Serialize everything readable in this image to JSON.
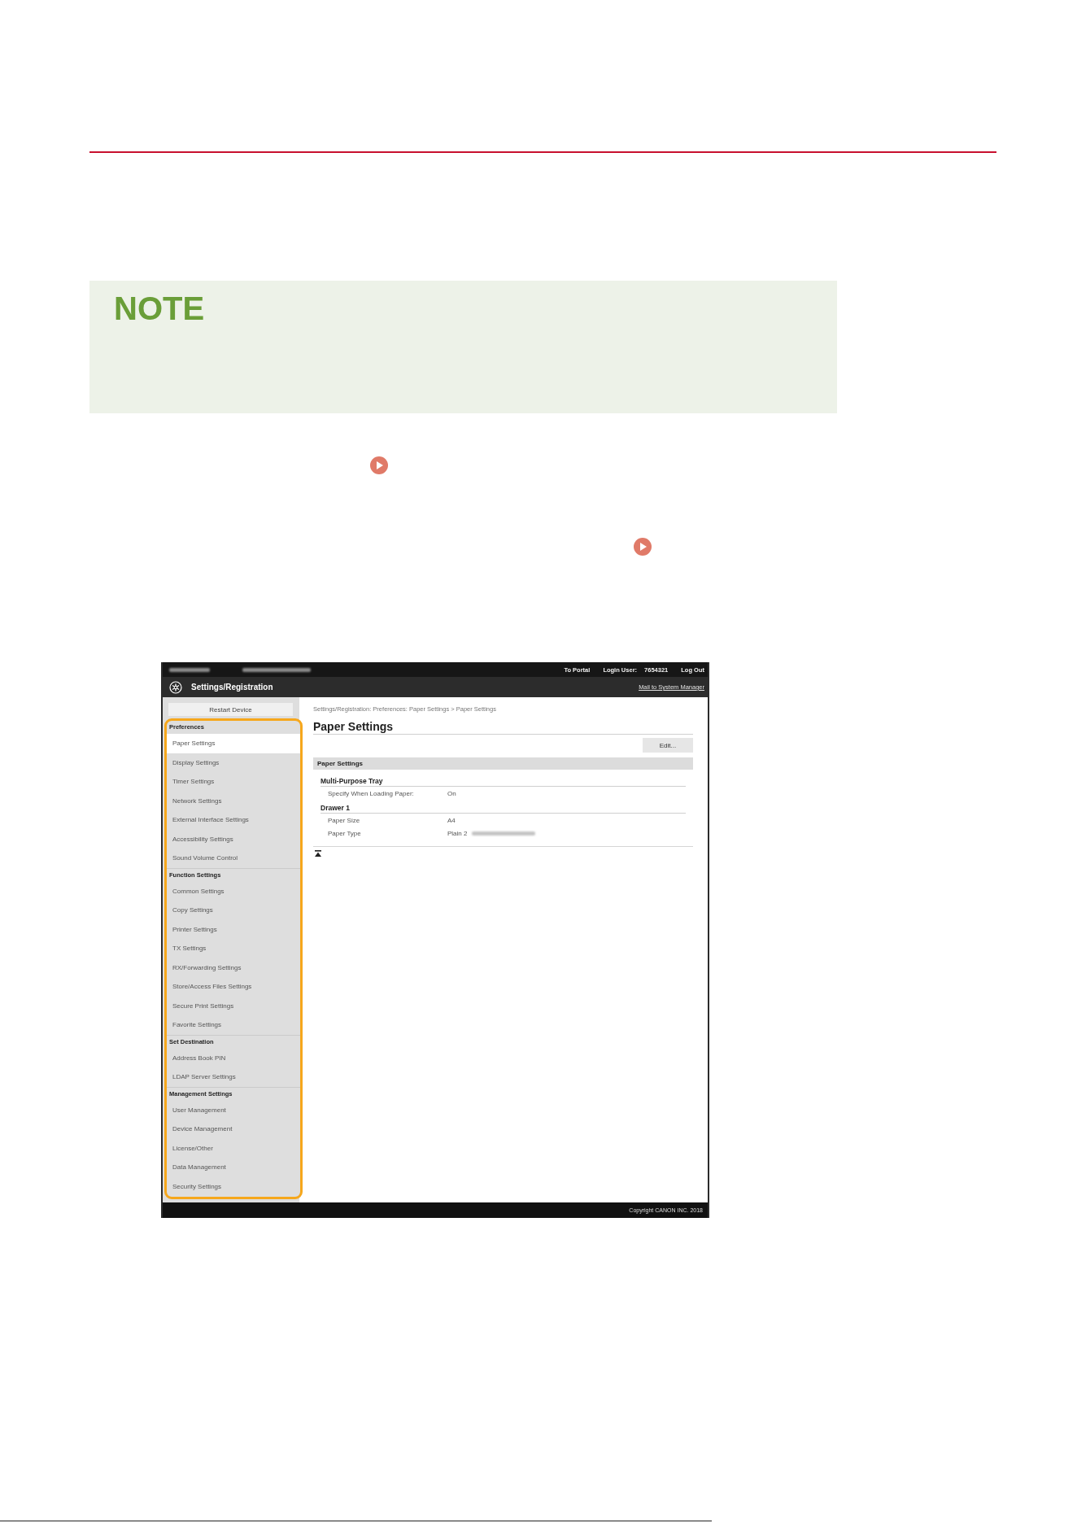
{
  "note": {
    "heading": "NOTE"
  },
  "screenshot": {
    "top_bar": {
      "items": [
        {
          "kind": "link",
          "text": "To Portal"
        },
        {
          "kind": "label",
          "text": "Login User:"
        },
        {
          "kind": "value",
          "text": "7654321"
        },
        {
          "kind": "link",
          "text": "Log Out"
        }
      ]
    },
    "header": {
      "title": "Settings/Registration",
      "link": "Mail to System Manager"
    },
    "sidebar": {
      "restart_button": "Restart Device",
      "sections": [
        {
          "heading": "Preferences",
          "items": [
            {
              "label": "Paper Settings",
              "selected": true
            },
            {
              "label": "Display Settings",
              "selected": false
            },
            {
              "label": "Timer Settings",
              "selected": false
            },
            {
              "label": "Network Settings",
              "selected": false
            },
            {
              "label": "External Interface Settings",
              "selected": false
            },
            {
              "label": "Accessibility Settings",
              "selected": false
            },
            {
              "label": "Sound Volume Control",
              "selected": false
            }
          ]
        },
        {
          "heading": "Function Settings",
          "items": [
            {
              "label": "Common Settings",
              "selected": false
            },
            {
              "label": "Copy Settings",
              "selected": false
            },
            {
              "label": "Printer Settings",
              "selected": false
            },
            {
              "label": "TX Settings",
              "selected": false
            },
            {
              "label": "RX/Forwarding Settings",
              "selected": false
            },
            {
              "label": "Store/Access Files Settings",
              "selected": false
            },
            {
              "label": "Secure Print Settings",
              "selected": false
            },
            {
              "label": "Favorite Settings",
              "selected": false
            }
          ]
        },
        {
          "heading": "Set Destination",
          "items": [
            {
              "label": "Address Book PIN",
              "selected": false
            },
            {
              "label": "LDAP Server Settings",
              "selected": false
            }
          ]
        },
        {
          "heading": "Management Settings",
          "items": [
            {
              "label": "User Management",
              "selected": false
            },
            {
              "label": "Device Management",
              "selected": false
            },
            {
              "label": "License/Other",
              "selected": false
            },
            {
              "label": "Data Management",
              "selected": false
            },
            {
              "label": "Security Settings",
              "selected": false
            }
          ]
        }
      ]
    },
    "content": {
      "breadcrumb": "Settings/Registration: Preferences: Paper Settings > Paper Settings",
      "title": "Paper Settings",
      "edit_button": "Edit...",
      "section": {
        "title": "Paper Settings",
        "groups": [
          {
            "heading": "Multi-Purpose Tray",
            "rows": [
              {
                "label": "Specify When Loading Paper:",
                "value": "On",
                "redacted": false
              }
            ]
          },
          {
            "heading": "Drawer 1",
            "rows": [
              {
                "label": "Paper Size",
                "value": "A4",
                "redacted": false
              },
              {
                "label": "Paper Type",
                "value": "Plain 2",
                "redacted": true
              }
            ]
          }
        ]
      }
    },
    "footer": {
      "copyright": "Copyright CANON INC. 2018"
    }
  }
}
